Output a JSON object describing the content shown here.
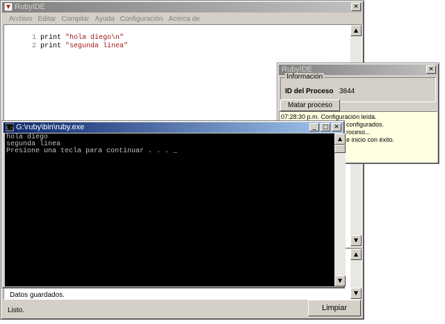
{
  "ide": {
    "title": "RubyIDE",
    "menu": [
      "Archivo",
      "Editar",
      "Compilar",
      "Ayuda",
      "Configuración",
      "Acerca de"
    ],
    "code": [
      {
        "num": "1",
        "kw": "print",
        "str": "\"hola diego\\n\""
      },
      {
        "num": "2",
        "kw": "print",
        "str": "\"segunda linea\""
      }
    ],
    "output_text": "Datos guardados.",
    "status": "Listo.",
    "clear_button": "Limpiar"
  },
  "process_window": {
    "title": "RubyIDE",
    "group_label": "Información",
    "pid_label": "ID del Proceso",
    "pid_value": "3844",
    "kill_button": "Matar proceso",
    "log": [
      "07:28:30 p.m. Configuración leída.",
      "configurados.",
      "roceso...",
      "e inicio con éxito."
    ]
  },
  "console": {
    "title": "G:\\ruby\\bin\\ruby.exe",
    "lines": [
      "hola diego",
      "segunda linea",
      "Presione una tecla para continuar . . . _"
    ]
  },
  "colors": {
    "active_title": "#0a246a",
    "inactive_title": "#808080",
    "log_background": "#ffffe1",
    "string_color": "#a31515"
  }
}
